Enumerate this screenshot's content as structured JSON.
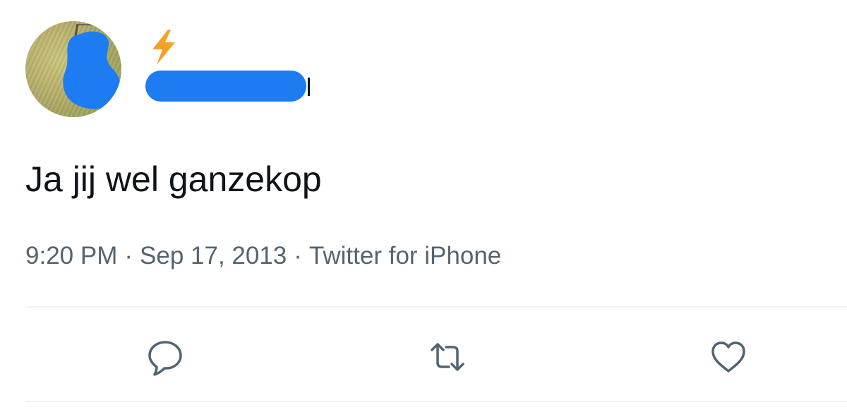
{
  "tweet": {
    "text": "Ja jij wel ganzekop",
    "time": "9:20 PM",
    "date": "Sep 17, 2013",
    "source": "Twitter for iPhone",
    "separator": "·"
  },
  "author": {
    "badge_icon": "lightning-bolt-icon",
    "redaction_color": "#1d7cf2"
  },
  "actions": [
    {
      "name": "reply-button",
      "icon": "speech-bubble-icon"
    },
    {
      "name": "retweet-button",
      "icon": "retweet-arrows-icon"
    },
    {
      "name": "like-button",
      "icon": "heart-icon"
    }
  ],
  "colors": {
    "text_primary": "#0f1419",
    "text_secondary": "#536471",
    "divider": "#eff3f4",
    "bolt": "#f4a12a",
    "redaction": "#1d7cf2"
  }
}
